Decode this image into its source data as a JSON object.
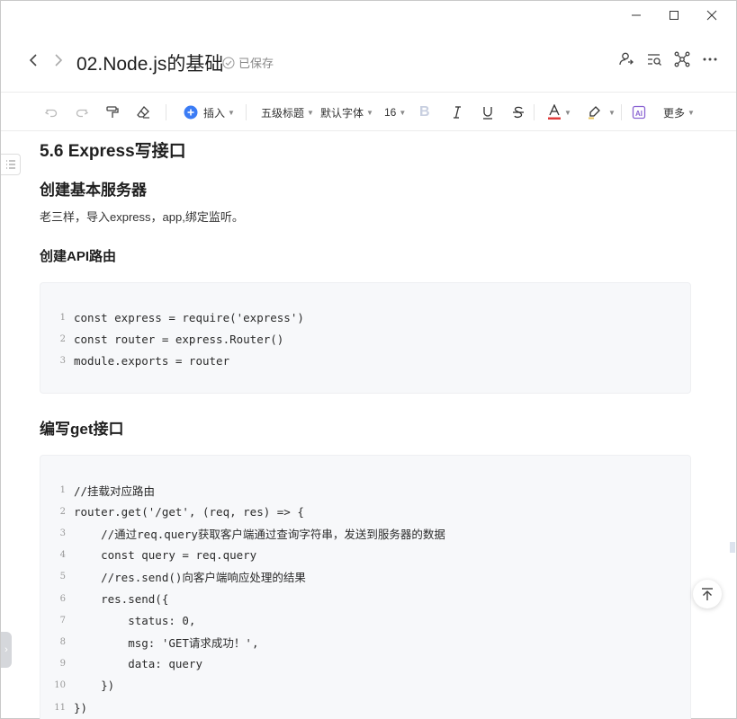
{
  "window": {
    "minimize_icon": "minimize-icon",
    "maximize_icon": "maximize-icon",
    "close_icon": "close-icon"
  },
  "titlebar": {
    "doc_title": "02.Node.js的基础",
    "save_status": "已保存",
    "actions": [
      "share-user-icon",
      "search-text-icon",
      "mindmap-icon",
      "more-icon"
    ]
  },
  "toolbar": {
    "insert_label": "插入",
    "heading_label": "五级标题",
    "font_label": "默认字体",
    "size_label": "16",
    "bold_label": "B",
    "more_label": "更多",
    "font_color": "#e03b3b",
    "insert_color": "#3b7cf5"
  },
  "content": {
    "h2": "5.6 Express写接口",
    "h3": "创建基本服务器",
    "para": "老三样，导入express，app,绑定监听。",
    "h4_api": "创建API路由",
    "code1": [
      {
        "n": "1",
        "t": "const express = require('express')"
      },
      {
        "n": "2",
        "t": "const router = express.Router()"
      },
      {
        "n": "3",
        "t": "module.exports = router"
      }
    ],
    "h3_get": "编写get接口",
    "code2": [
      {
        "n": "1",
        "t": "//挂载对应路由"
      },
      {
        "n": "2",
        "t": "router.get('/get', (req, res) => {"
      },
      {
        "n": "3",
        "t": "    //通过req.query获取客户端通过查询字符串，发送到服务器的数据"
      },
      {
        "n": "4",
        "t": "    const query = req.query"
      },
      {
        "n": "5",
        "t": "    //res.send()向客户端响应处理的结果"
      },
      {
        "n": "6",
        "t": "    res.send({"
      },
      {
        "n": "7",
        "t": "        status: 0,"
      },
      {
        "n": "8",
        "t": "        msg: 'GET请求成功！',"
      },
      {
        "n": "9",
        "t": "        data: query"
      },
      {
        "n": "10",
        "t": "    })"
      },
      {
        "n": "11",
        "t": "})"
      }
    ]
  }
}
